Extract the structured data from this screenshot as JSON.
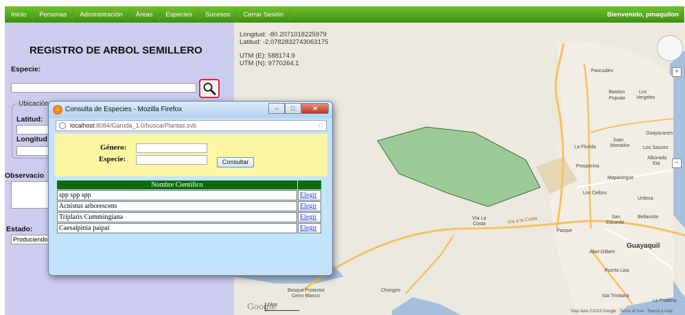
{
  "nav": {
    "items": [
      "Inicio",
      "Personas",
      "Administración",
      "Áreas",
      "Especies",
      "Sucesos",
      "Cerrar Sesión"
    ],
    "welcome": "Bienvenido, pmaquilon"
  },
  "form": {
    "title": "REGISTRO DE ARBOL SEMILLERO",
    "especie_label": "Especie:",
    "ubicacion_legend": "Ubicación",
    "latitud_label": "Latitud:",
    "longitud_label": "Longitud",
    "observaciones_label": "Observacio",
    "estado_label": "Estado:",
    "estado_value": "Produciendo"
  },
  "map": {
    "longitud": "Longitud: -80.2071018225979",
    "latitud": "Latitud: -2.0782832743063175",
    "utm_e": "UTM (E): 588174.9",
    "utm_n": "UTM (N): 9770264.1",
    "labels": {
      "pascuales": "Pascuales",
      "bastion": "Bastion",
      "popular": "Popular",
      "los": "Los",
      "vergeles": "Vergeles",
      "guayacanes": "Guayacanes",
      "juan": "Juan",
      "montalvo": "Montalvo",
      "la_florida": "La Florida",
      "los_sauces": "Los Sauces",
      "alborada": "Alborada",
      "eta": "Eta",
      "prosperina": "Prosperina",
      "mapasingue": "Mapasingue",
      "los_ceibos": "Los Ceibos",
      "urdesa": "Urdesa",
      "via_la": "Vía La",
      "costa": "Costa",
      "via_a_la_costa": "Vía a la Costa",
      "san": "San",
      "eduardo": "Eduardo",
      "bellavista": "Bellavista",
      "parque": "Parque",
      "guayaquil": "Guayaquil",
      "abel_gilbert": "Abel Gilbert",
      "puerto_lisa": "Puerto Lisa",
      "bosque": "Bosque Protector",
      "cerro": "Cerro Blanco",
      "chongon": "Chongón",
      "isla_trinitaria": "Isla Trinitaria",
      "la_pradera": "La Pradera"
    },
    "google": "Google",
    "scale": "2 km",
    "footer": "Map data ©2013 Google · Terms of Use · Report a map"
  },
  "popup": {
    "title": "Consulta de Especies - Mozilla Firefox",
    "url_host": "localhost",
    "url_path": ":8084/Garuda_1.0/buscarPlantas.svb",
    "genero_label": "Género:",
    "especie_label": "Especie:",
    "consultar_label": "Consultar",
    "col_header": "Nombre Científico",
    "rows": [
      {
        "name": "spp spp spp",
        "link": "Elegir"
      },
      {
        "name": "Acnistus arborescens",
        "link": "Elegir"
      },
      {
        "name": "Triplaris Cummingiana",
        "link": "Elegir"
      },
      {
        "name": "Caesalpinia paipai",
        "link": "Elegir"
      }
    ]
  },
  "colors": {
    "nav_green": "#4e9f1c",
    "panel_lavender": "#ccccee",
    "table_header": "#0e6a0e",
    "form_yellow": "#fbf6a2",
    "polygon_fill": "#8fc68a"
  }
}
